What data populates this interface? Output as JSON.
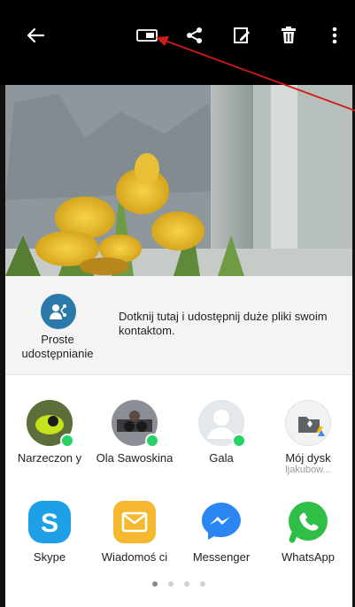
{
  "toolbar": {
    "icons": [
      "back-arrow-icon",
      "cast-icon",
      "share-icon",
      "edit-icon",
      "delete-icon",
      "more-options-icon"
    ]
  },
  "direct_share": {
    "label": "Proste udostępnianie",
    "description": "Dotknij tutaj i udostępnij duże pliki swoim kontaktom.",
    "icon": "direct-share-icon",
    "color": "#2b78ab"
  },
  "contacts": [
    {
      "name": "Narzeczon y",
      "sub": ""
    },
    {
      "name": "Ola Sawoskina",
      "sub": ""
    },
    {
      "name": "Gala",
      "sub": ""
    },
    {
      "name": "Mój dysk",
      "sub": "ljakubow..."
    }
  ],
  "apps": [
    {
      "name": "Skype",
      "icon": "skype-icon",
      "color": "#1ea0e6"
    },
    {
      "name": "Wiadomoś ci",
      "icon": "messages-icon",
      "color": "#f5b82e"
    },
    {
      "name": "Messenger",
      "icon": "messenger-icon",
      "color": "#2c86f2"
    },
    {
      "name": "WhatsApp",
      "icon": "whatsapp-icon",
      "color": "#2fbf47"
    }
  ],
  "pagination": {
    "pages": 4,
    "current": 1
  }
}
